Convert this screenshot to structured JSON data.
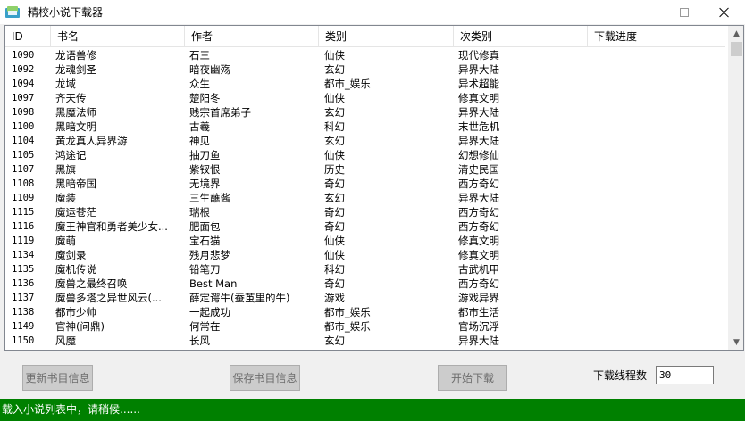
{
  "window": {
    "title": "精校小说下载器"
  },
  "table": {
    "headers": [
      "ID",
      "书名",
      "作者",
      "类别",
      "次类别",
      "下载进度"
    ],
    "rows": [
      [
        "1090",
        "龙语兽修",
        "石三",
        "仙侠",
        "现代修真",
        ""
      ],
      [
        "1092",
        "龙魂剑圣",
        "暗夜幽殇",
        "玄幻",
        "异界大陆",
        ""
      ],
      [
        "1094",
        "龙域",
        "众生",
        "都市_娱乐",
        "异术超能",
        ""
      ],
      [
        "1097",
        "齐天传",
        "楚阳冬",
        "仙侠",
        "修真文明",
        ""
      ],
      [
        "1098",
        "黑魔法师",
        "贱宗首席弟子",
        "玄幻",
        "异界大陆",
        ""
      ],
      [
        "1100",
        "黑暗文明",
        "古羲",
        "科幻",
        "末世危机",
        ""
      ],
      [
        "1104",
        "黄龙真人异界游",
        "神见",
        "玄幻",
        "异界大陆",
        ""
      ],
      [
        "1105",
        "鸿途记",
        "抽刀鱼",
        "仙侠",
        "幻想修仙",
        ""
      ],
      [
        "1107",
        "黑旗",
        "紫钗恨",
        "历史",
        "清史民国",
        ""
      ],
      [
        "1108",
        "黑暗帝国",
        "无境界",
        "奇幻",
        "西方奇幻",
        ""
      ],
      [
        "1109",
        "魔装",
        "三生蘸酱",
        "玄幻",
        "异界大陆",
        ""
      ],
      [
        "1115",
        "魔运苍茫",
        "瑞根",
        "奇幻",
        "西方奇幻",
        ""
      ],
      [
        "1116",
        "魔王神官和勇者美少女...",
        "肥面包",
        "奇幻",
        "西方奇幻",
        ""
      ],
      [
        "1119",
        "魔萌",
        "宝石猫",
        "仙侠",
        "修真文明",
        ""
      ],
      [
        "1134",
        "魔剑录",
        "残月悲梦",
        "仙侠",
        "修真文明",
        ""
      ],
      [
        "1135",
        "魔机传说",
        "铅笔刀",
        "科幻",
        "古武机甲",
        ""
      ],
      [
        "1136",
        "魔兽之最终召唤",
        "Best Man",
        "奇幻",
        "西方奇幻",
        ""
      ],
      [
        "1137",
        "魔兽多塔之异世风云(...",
        "薛定谔牛(蚕茧里的牛)",
        "游戏",
        "游戏异界",
        ""
      ],
      [
        "1138",
        "都市少帅",
        "一起成功",
        "都市_娱乐",
        "都市生活",
        ""
      ],
      [
        "1149",
        "官神(问鼎)",
        "何常在",
        "都市_娱乐",
        "官场沉浮",
        ""
      ],
      [
        "1150",
        "风魔",
        "长风",
        "玄幻",
        "异界大陆",
        ""
      ]
    ]
  },
  "buttons": {
    "update_catalog": "更新书目信息",
    "save_catalog": "保存书目信息",
    "start_download": "开始下载"
  },
  "threads": {
    "label": "下载线程数",
    "value": "30"
  },
  "status": {
    "text": "载入小说列表中，请稍候......"
  },
  "colors": {
    "status_bg": "#008000",
    "status_fg": "#ffffff",
    "button_bg": "#cccccc",
    "button_fg": "#6d6d6d"
  },
  "icons": {
    "app": "books-icon",
    "minimize": "minimize-icon",
    "maximize": "maximize-icon",
    "close": "close-icon",
    "scroll_up": "chevron-up-icon",
    "scroll_down": "chevron-down-icon"
  }
}
